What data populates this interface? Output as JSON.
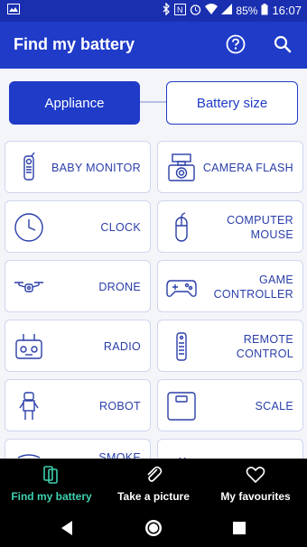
{
  "status_bar": {
    "battery_pct": "85%",
    "time": "16:07"
  },
  "app_bar": {
    "title": "Find my battery"
  },
  "toggle": {
    "active": "Appliance",
    "inactive": "Battery size"
  },
  "items": [
    {
      "label": "BABY MONITOR",
      "icon": "baby-monitor-icon"
    },
    {
      "label": "CAMERA FLASH",
      "icon": "camera-flash-icon"
    },
    {
      "label": "CLOCK",
      "icon": "clock-icon"
    },
    {
      "label": "COMPUTER MOUSE",
      "icon": "mouse-icon"
    },
    {
      "label": "DRONE",
      "icon": "drone-icon"
    },
    {
      "label": "GAME CONTROLLER",
      "icon": "gamepad-icon"
    },
    {
      "label": "RADIO",
      "icon": "radio-icon"
    },
    {
      "label": "REMOTE CONTROL",
      "icon": "remote-icon"
    },
    {
      "label": "ROBOT",
      "icon": "robot-icon"
    },
    {
      "label": "SCALE",
      "icon": "scale-icon"
    },
    {
      "label": "SMOKE",
      "icon": "smoke-detector-icon"
    },
    {
      "label": "",
      "icon": "unknown-icon"
    }
  ],
  "bottom_nav": [
    {
      "label": "Find my battery",
      "icon": "battery-search-icon",
      "active": true
    },
    {
      "label": "Take a picture",
      "icon": "paperclip-icon",
      "active": false
    },
    {
      "label": "My favourites",
      "icon": "heart-icon",
      "active": false
    }
  ],
  "colors": {
    "primary": "#1f3bc8",
    "accent": "#3fd0b0"
  }
}
